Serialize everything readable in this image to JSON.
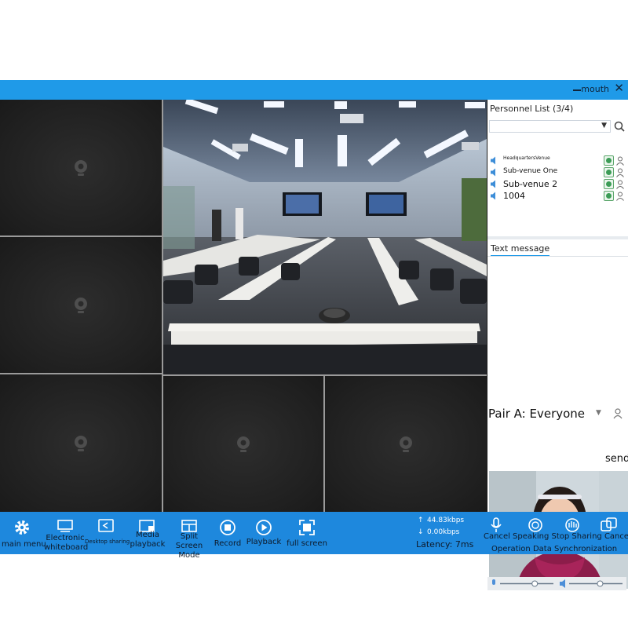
{
  "window": {
    "title": "mouth",
    "close_glyph": "✕"
  },
  "personnel": {
    "heading": "Personnel List (3/4)",
    "filter": {
      "value": ""
    },
    "members": [
      {
        "name": "HeadquartersVenue",
        "size": 6
      },
      {
        "name": "Sub-venue One",
        "size": 9
      },
      {
        "name": "Sub-venue 2",
        "size": 11
      },
      {
        "name": "1004",
        "size": 11
      }
    ]
  },
  "messages": {
    "tab_label": "Text message",
    "recipient": "Pair A: Everyone",
    "send_label": "send"
  },
  "toolbar": {
    "main_menu": "main menu",
    "whiteboard": "Electronic whiteboard",
    "desktop_sharing": "Desktop sharing",
    "media_playback": "Media playback",
    "split_screen": "Split Screen Mode",
    "record": "Record",
    "playback": "Playback",
    "full_screen": "full screen",
    "upload_rate": "44.83kbps",
    "download_rate": "0.00kbps",
    "latency": "Latency: 7ms",
    "upload_arrow": "↑",
    "download_arrow": "↓",
    "right_actions": "Cancel Speaking Stop Sharing Cancel",
    "operation_sync": "Operation Data Synchronization"
  },
  "audio": {
    "mic_level": 0.65,
    "speaker_level": 0.58
  },
  "colors": {
    "title_bar": "#1f9ae8",
    "toolbar": "#1e88dd",
    "grid": "#9a9a9a",
    "tile": "#252525"
  }
}
